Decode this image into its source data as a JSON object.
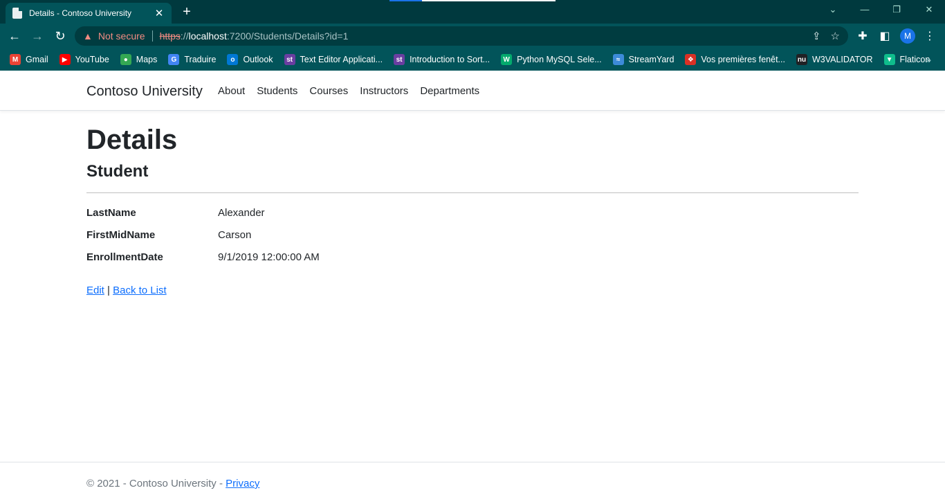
{
  "browser": {
    "tab_title": "Details - Contoso University",
    "tab_close": "✕",
    "new_tab": "+",
    "security_label": "Not secure",
    "url_scheme": "https",
    "url_sep": "://",
    "url_host": "localhost",
    "url_path": ":7200/Students/Details?id=1",
    "avatar_letter": "M",
    "bookmarks": [
      {
        "label": "Gmail",
        "color": "#ea4335",
        "glyph": "M"
      },
      {
        "label": "YouTube",
        "color": "#ff0000",
        "glyph": "▶"
      },
      {
        "label": "Maps",
        "color": "#34a853",
        "glyph": "●"
      },
      {
        "label": "Traduire",
        "color": "#4285f4",
        "glyph": "G"
      },
      {
        "label": "Outlook",
        "color": "#0078d4",
        "glyph": "o"
      },
      {
        "label": "Text Editor Applicati...",
        "color": "#6a3ea1",
        "glyph": "st"
      },
      {
        "label": "Introduction to Sort...",
        "color": "#6a3ea1",
        "glyph": "st"
      },
      {
        "label": "Python MySQL Sele...",
        "color": "#04aa6d",
        "glyph": "W"
      },
      {
        "label": "StreamYard",
        "color": "#3d8bd9",
        "glyph": "≈"
      },
      {
        "label": "Vos premières fenêt...",
        "color": "#d93025",
        "glyph": "❖"
      },
      {
        "label": "W3VALIDATOR",
        "color": "#202124",
        "glyph": "nu"
      },
      {
        "label": "Flaticon",
        "color": "#0fbd8c",
        "glyph": "▼"
      }
    ]
  },
  "site": {
    "brand": "Contoso University",
    "nav": [
      "About",
      "Students",
      "Courses",
      "Instructors",
      "Departments"
    ]
  },
  "main": {
    "title": "Details",
    "subtitle": "Student",
    "fields": [
      {
        "label": "LastName",
        "value": "Alexander"
      },
      {
        "label": "FirstMidName",
        "value": "Carson"
      },
      {
        "label": "EnrollmentDate",
        "value": "9/1/2019 12:00:00 AM"
      }
    ],
    "edit_link": "Edit",
    "separator": " | ",
    "back_link": "Back to List"
  },
  "footer": {
    "text": "© 2021 - Contoso University - ",
    "privacy_link": "Privacy"
  }
}
